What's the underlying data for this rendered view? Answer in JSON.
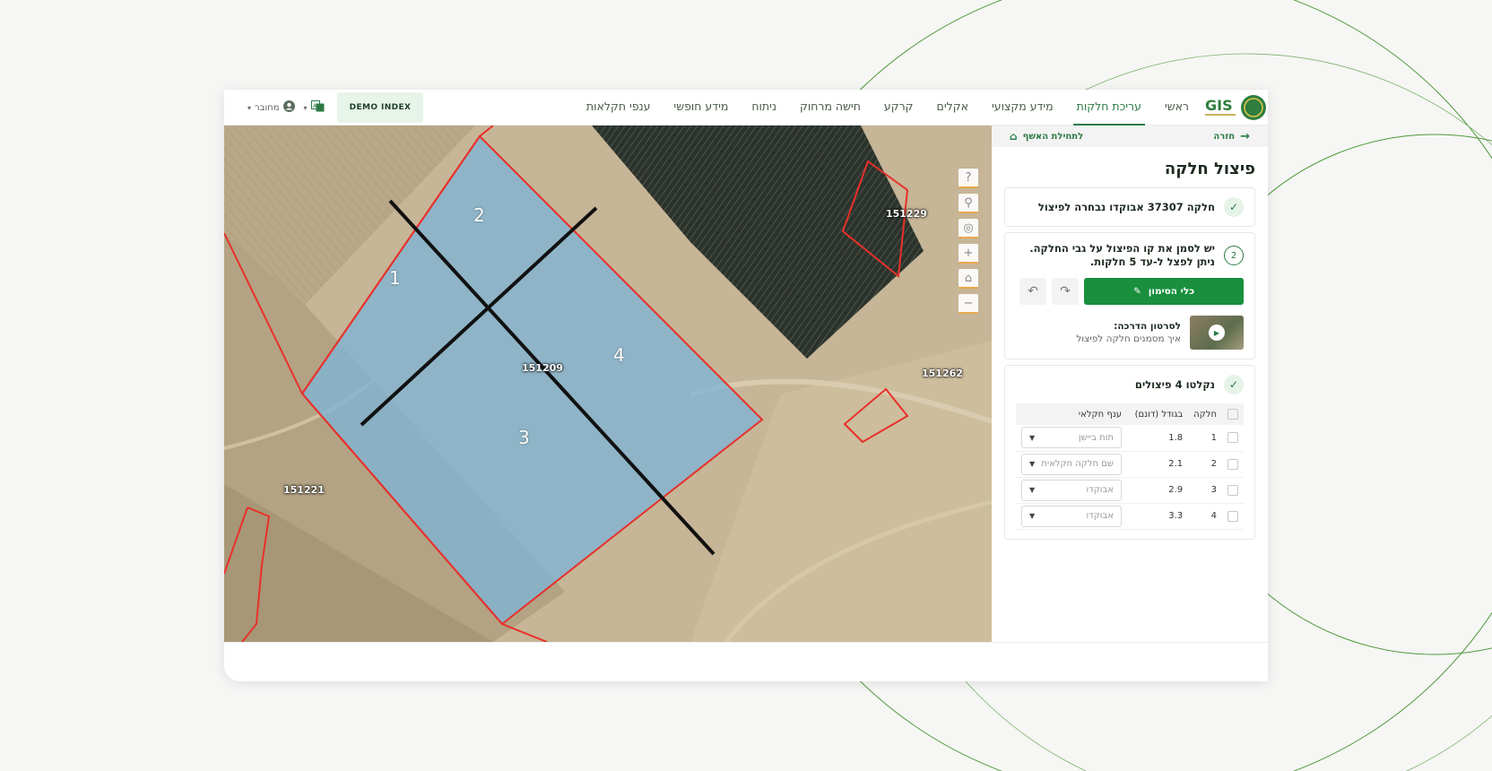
{
  "header": {
    "nav": [
      "ראשי",
      "עריכת חלקות",
      "מידע מקצועי",
      "אקלים",
      "קרקע",
      "חישה מרחוק",
      "ניתוח",
      "מידע חופשי",
      "ענפי חקלאות"
    ],
    "active_nav": "עריכת חלקות",
    "demo_label": "DEMO INDEX",
    "user_label": "מחובר",
    "logo_text": "GIS"
  },
  "map": {
    "parcels": [
      "151229",
      "151209",
      "151262",
      "151221"
    ],
    "sections": [
      "1",
      "2",
      "3",
      "4"
    ],
    "controls": [
      "help-icon",
      "search-icon",
      "locate-icon",
      "zoom-in-icon",
      "home-icon",
      "zoom-out-icon"
    ]
  },
  "panel": {
    "back_label": "חזרה",
    "home_label": "לתחילת האשף",
    "title": "פיצול חלקה",
    "step1": {
      "parcel_word": "חלקה",
      "parcel_id": "37307",
      "crop": "אבוקדו",
      "suffix": "נבחרה לפיצול"
    },
    "step2": {
      "number": "2",
      "line1": "יש לסמן את קו הפיצול על גבי החלקה.",
      "line2": "ניתן לפצל ל-עד 5 חלקות.",
      "draw_button": "כלי הסימון",
      "video_title": "לסרטון הדרכה:",
      "video_subtitle": "איך מסמנים חלקה לפיצול"
    },
    "step3": {
      "title": "נקלטו 4 פיצולים",
      "columns": [
        "חלקה",
        "בגודל (דונם)",
        "ענף חקלאי"
      ],
      "rows": [
        {
          "id": "1",
          "size": "1.8",
          "branch": "תות ביישן"
        },
        {
          "id": "2",
          "size": "2.1",
          "branch": "שם חלקה חקלאית"
        },
        {
          "id": "3",
          "size": "2.9",
          "branch": "אבוקדו"
        },
        {
          "id": "4",
          "size": "3.3",
          "branch": "אבוקדו"
        }
      ]
    }
  },
  "colors": {
    "accent": "#2b7a44",
    "button": "#1a8f3e",
    "parcel_outline": "#e8302a",
    "selected_fill": "#7fb3d6"
  }
}
